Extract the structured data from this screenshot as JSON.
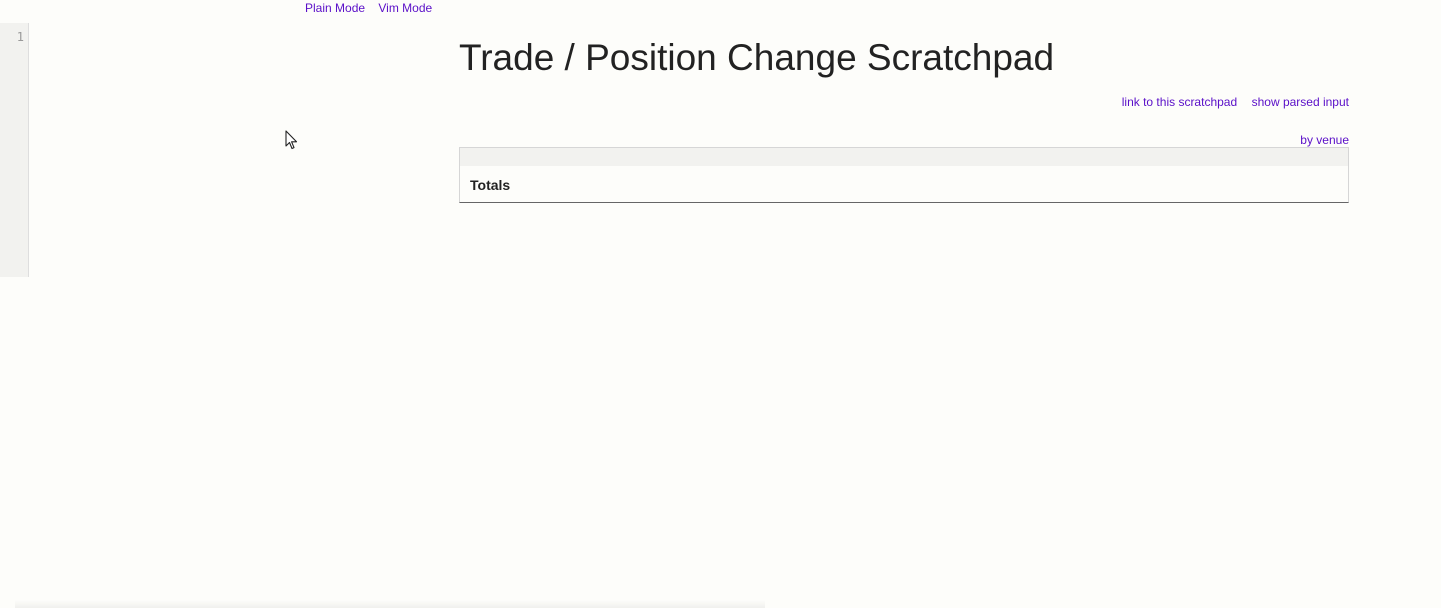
{
  "mode_bar": {
    "plain_mode_label": "Plain Mode",
    "vim_mode_label": "Vim Mode"
  },
  "editor": {
    "line_numbers": [
      "1"
    ],
    "content": ""
  },
  "main": {
    "title": "Trade / Position Change Scratchpad",
    "link_scratchpad_label": "link to this scratchpad",
    "show_parsed_label": "show parsed input",
    "group_by_label": "by venue",
    "table": {
      "totals_label": "Totals"
    }
  },
  "colors": {
    "link": "#5a0fc8",
    "background": "#fdfdfa",
    "gutter": "#f2f2ef"
  }
}
